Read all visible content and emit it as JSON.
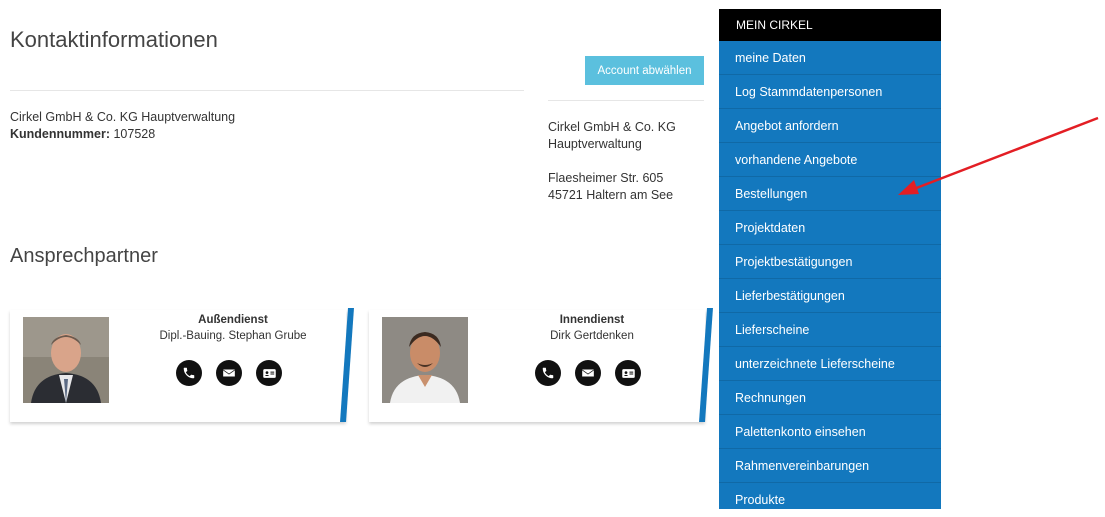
{
  "contact": {
    "heading": "Kontaktinformationen",
    "company": "Cirkel GmbH & Co. KG Hauptverwaltung",
    "customer_label": "Kundennummer:",
    "customer_number": " 107528",
    "deselect_button": "Account abwählen",
    "address": {
      "company_line1": "Cirkel GmbH & Co. KG",
      "company_line2": "Hauptverwaltung",
      "street": "Flaesheimer Str. 605",
      "city": "45721 Haltern am See"
    }
  },
  "contacts": {
    "heading": "Ansprechpartner",
    "people": [
      {
        "role": "Außendienst",
        "name": "Dipl.-Bauing. Stephan Grube"
      },
      {
        "role": "Innendienst",
        "name": "Dirk Gertdenken"
      }
    ],
    "icons": [
      "phone-icon",
      "envelope-icon",
      "vcard-icon"
    ]
  },
  "sidebar": {
    "title": "MEIN CIRKEL",
    "items": [
      {
        "label": "meine Daten"
      },
      {
        "label": "Log Stammdatenpersonen"
      },
      {
        "label": "Angebot anfordern"
      },
      {
        "label": "vorhandene Angebote"
      },
      {
        "label": "Bestellungen"
      },
      {
        "label": "Projektdaten"
      },
      {
        "label": "Projektbestätigungen"
      },
      {
        "label": "Lieferbestätigungen"
      },
      {
        "label": "Lieferscheine"
      },
      {
        "label": "unterzeichnete Lieferscheine"
      },
      {
        "label": "Rechnungen"
      },
      {
        "label": "Palettenkonto einsehen"
      },
      {
        "label": "Rahmenvereinbarungen"
      },
      {
        "label": "Produkte"
      }
    ]
  },
  "colors": {
    "sidebar_blue": "#1378be",
    "sidebar_header": "#000000",
    "button_cyan": "#5bc0de",
    "annotation_red": "#e31e24"
  }
}
